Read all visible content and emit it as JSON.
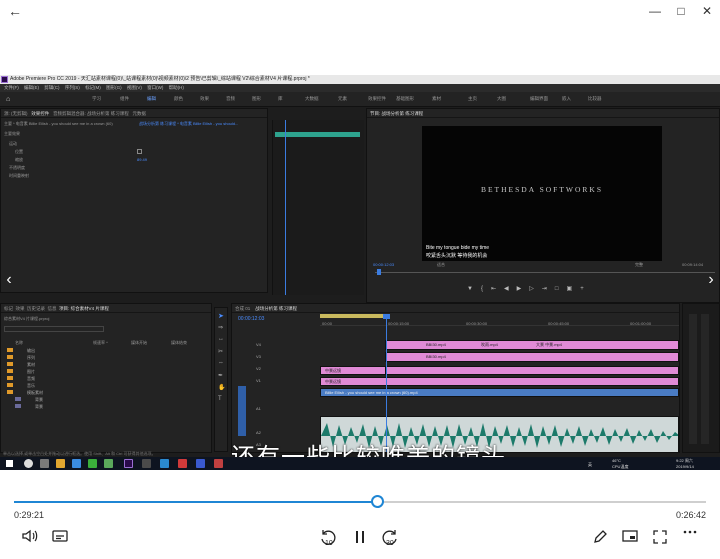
{
  "viewer": {
    "back_icon": "back-arrow-icon",
    "window_controls": [
      "minimize-icon",
      "maximize-icon",
      "close-icon"
    ]
  },
  "premiere": {
    "title": "Adobe Premiere Pro CC 2019 - 天汇站素材课程(0)\\_站课程素材(0)\\视频素材(0)\\2 预告\\已剪辑\\_综站课程 V2\\综合素材V4 片课程.prproj *",
    "menu": [
      "文件(F)",
      "编辑(E)",
      "剪辑(C)",
      "序列(S)",
      "标记(M)",
      "图形(G)",
      "视图(V)",
      "窗口(W)",
      "帮助(H)"
    ],
    "workspaces": [
      "学习",
      "组件",
      "编辑",
      "颜色",
      "效果",
      "音频",
      "图形",
      "库",
      "大数据",
      "元素",
      "效果控件",
      "基础图形",
      "素材",
      "主页",
      "大图",
      "编辑界面",
      "嵌入",
      "比较器"
    ],
    "active_workspace": "编辑",
    "source_tabs": [
      "源: (无剪辑)",
      "效果控件",
      "音频剪辑混合器: 战场分析第 练习课程",
      "元数据"
    ],
    "source_clip": "主要 * 电音素 Billie Eilish - you should see me in a crown (60)",
    "sequence_clip": "战场分析第 练习课程 * 电音素 Billie Eilish - you should...",
    "fx_title": "主要效果",
    "fx_rows": [
      "运动",
      "不透明度",
      "时间重映射"
    ],
    "fx_sub": [
      "位置",
      "缩放"
    ],
    "fx_value": "89.49",
    "monitor_tab": "节目: 战场分析第 练习课程",
    "monitor_time": "00:00:12:03",
    "monitor_duration": "00:09:14:04",
    "fit_label": "适合",
    "quality_label": "完整",
    "watermark": "BETHESDA SOFTWORKS",
    "subtitle_en": "Bite my tongue bide my time",
    "subtitle_cn": "咬紧舌头沉默 等待我的机会",
    "project_tabs": [
      "项目: 综合素材V4 片课程",
      "媒体浏览器",
      "库",
      "信息",
      "效果",
      "标记",
      "历史记录"
    ],
    "project_name": "综合素材V4 片课程.prproj",
    "project_columns": [
      "名称",
      "帧速率 ^",
      "媒体开始",
      "媒体结束"
    ],
    "bins": [
      "输出",
      "序列",
      "素材",
      "图片",
      "音频",
      "音乐",
      "模板素材",
      "背景",
      "背景"
    ],
    "timeline_tabs": [
      "合成 01",
      "战场分析第 练习课程"
    ],
    "timeline_time": "00:00:12:03",
    "ruler_marks": [
      "00:00",
      "00:00:15:00",
      "00:00:30:00",
      "00:00:45:00",
      "00:01:00:00"
    ],
    "video_tracks": [
      "V4",
      "V3",
      "V2",
      "V1"
    ],
    "audio_tracks": [
      "A1",
      "A2",
      "A3"
    ],
    "track_clips": {
      "v3_label": "中景远镜",
      "v2_label": "中景远镜",
      "v1_label": "Billie Eilish - you should see me in a crown (60).mp4",
      "v4_a": "BBI30.mp4",
      "v4_b": "吹雨.mp4",
      "v4_c": "BBI30.mp4",
      "v4_d": "大景 中景.mp4"
    },
    "sub_title_bottom": "项目素材组: 项目素材",
    "status_bar": "单击以选择,或单击空白处并拖动以进行框选。使用 Shift、Alt 和 Ctrl 可获得其他选项。"
  },
  "caption_cn": "还有一些比较唯美的镜头",
  "taskbar": {
    "weather": "46°C",
    "weather_sub": "CPU温度",
    "time": "9:22 周六",
    "date": "2019/9/14",
    "tray": "英"
  },
  "player": {
    "elapsed": "0:29:21",
    "remaining": "0:26:42",
    "progress": 0.524,
    "rewind_seconds": "10",
    "forward_seconds": "30"
  }
}
